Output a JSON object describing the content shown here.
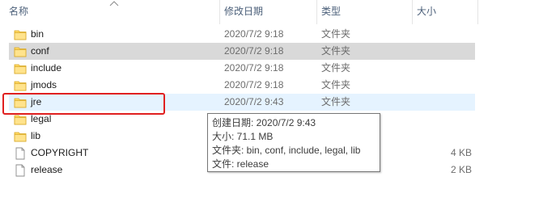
{
  "columns": {
    "name": "名称",
    "modified": "修改日期",
    "type": "类型",
    "size": "大小"
  },
  "rows": [
    {
      "name": "bin",
      "modified": "2020/7/2 9:18",
      "type": "文件夹",
      "size": "",
      "icon": "folder-icon"
    },
    {
      "name": "conf",
      "modified": "2020/7/2 9:18",
      "type": "文件夹",
      "size": "",
      "icon": "folder-icon"
    },
    {
      "name": "include",
      "modified": "2020/7/2 9:18",
      "type": "文件夹",
      "size": "",
      "icon": "folder-icon"
    },
    {
      "name": "jmods",
      "modified": "2020/7/2 9:18",
      "type": "文件夹",
      "size": "",
      "icon": "folder-icon"
    },
    {
      "name": "jre",
      "modified": "2020/7/2 9:43",
      "type": "文件夹",
      "size": "",
      "icon": "folder-icon"
    },
    {
      "name": "legal",
      "modified": "",
      "type": "",
      "size": "",
      "icon": "folder-icon"
    },
    {
      "name": "lib",
      "modified": "",
      "type": "",
      "size": "",
      "icon": "folder-icon"
    },
    {
      "name": "COPYRIGHT",
      "modified": "",
      "type": "",
      "size": "4 KB",
      "icon": "file-icon"
    },
    {
      "name": "release",
      "modified": "",
      "type": "",
      "size": "2 KB",
      "icon": "file-icon"
    }
  ],
  "selected_row": "conf",
  "hovered_row": "jre",
  "tooltip": {
    "created": "创建日期: 2020/7/2 9:43",
    "size": "大小: 71.1 MB",
    "folders": "文件夹: bin, conf, include, legal, lib",
    "files": "文件: release"
  },
  "colors": {
    "folder": "#ffd862",
    "selected_bg": "#d9d9d9",
    "hover_bg": "#e5f3ff",
    "highlight": "#e02020"
  }
}
